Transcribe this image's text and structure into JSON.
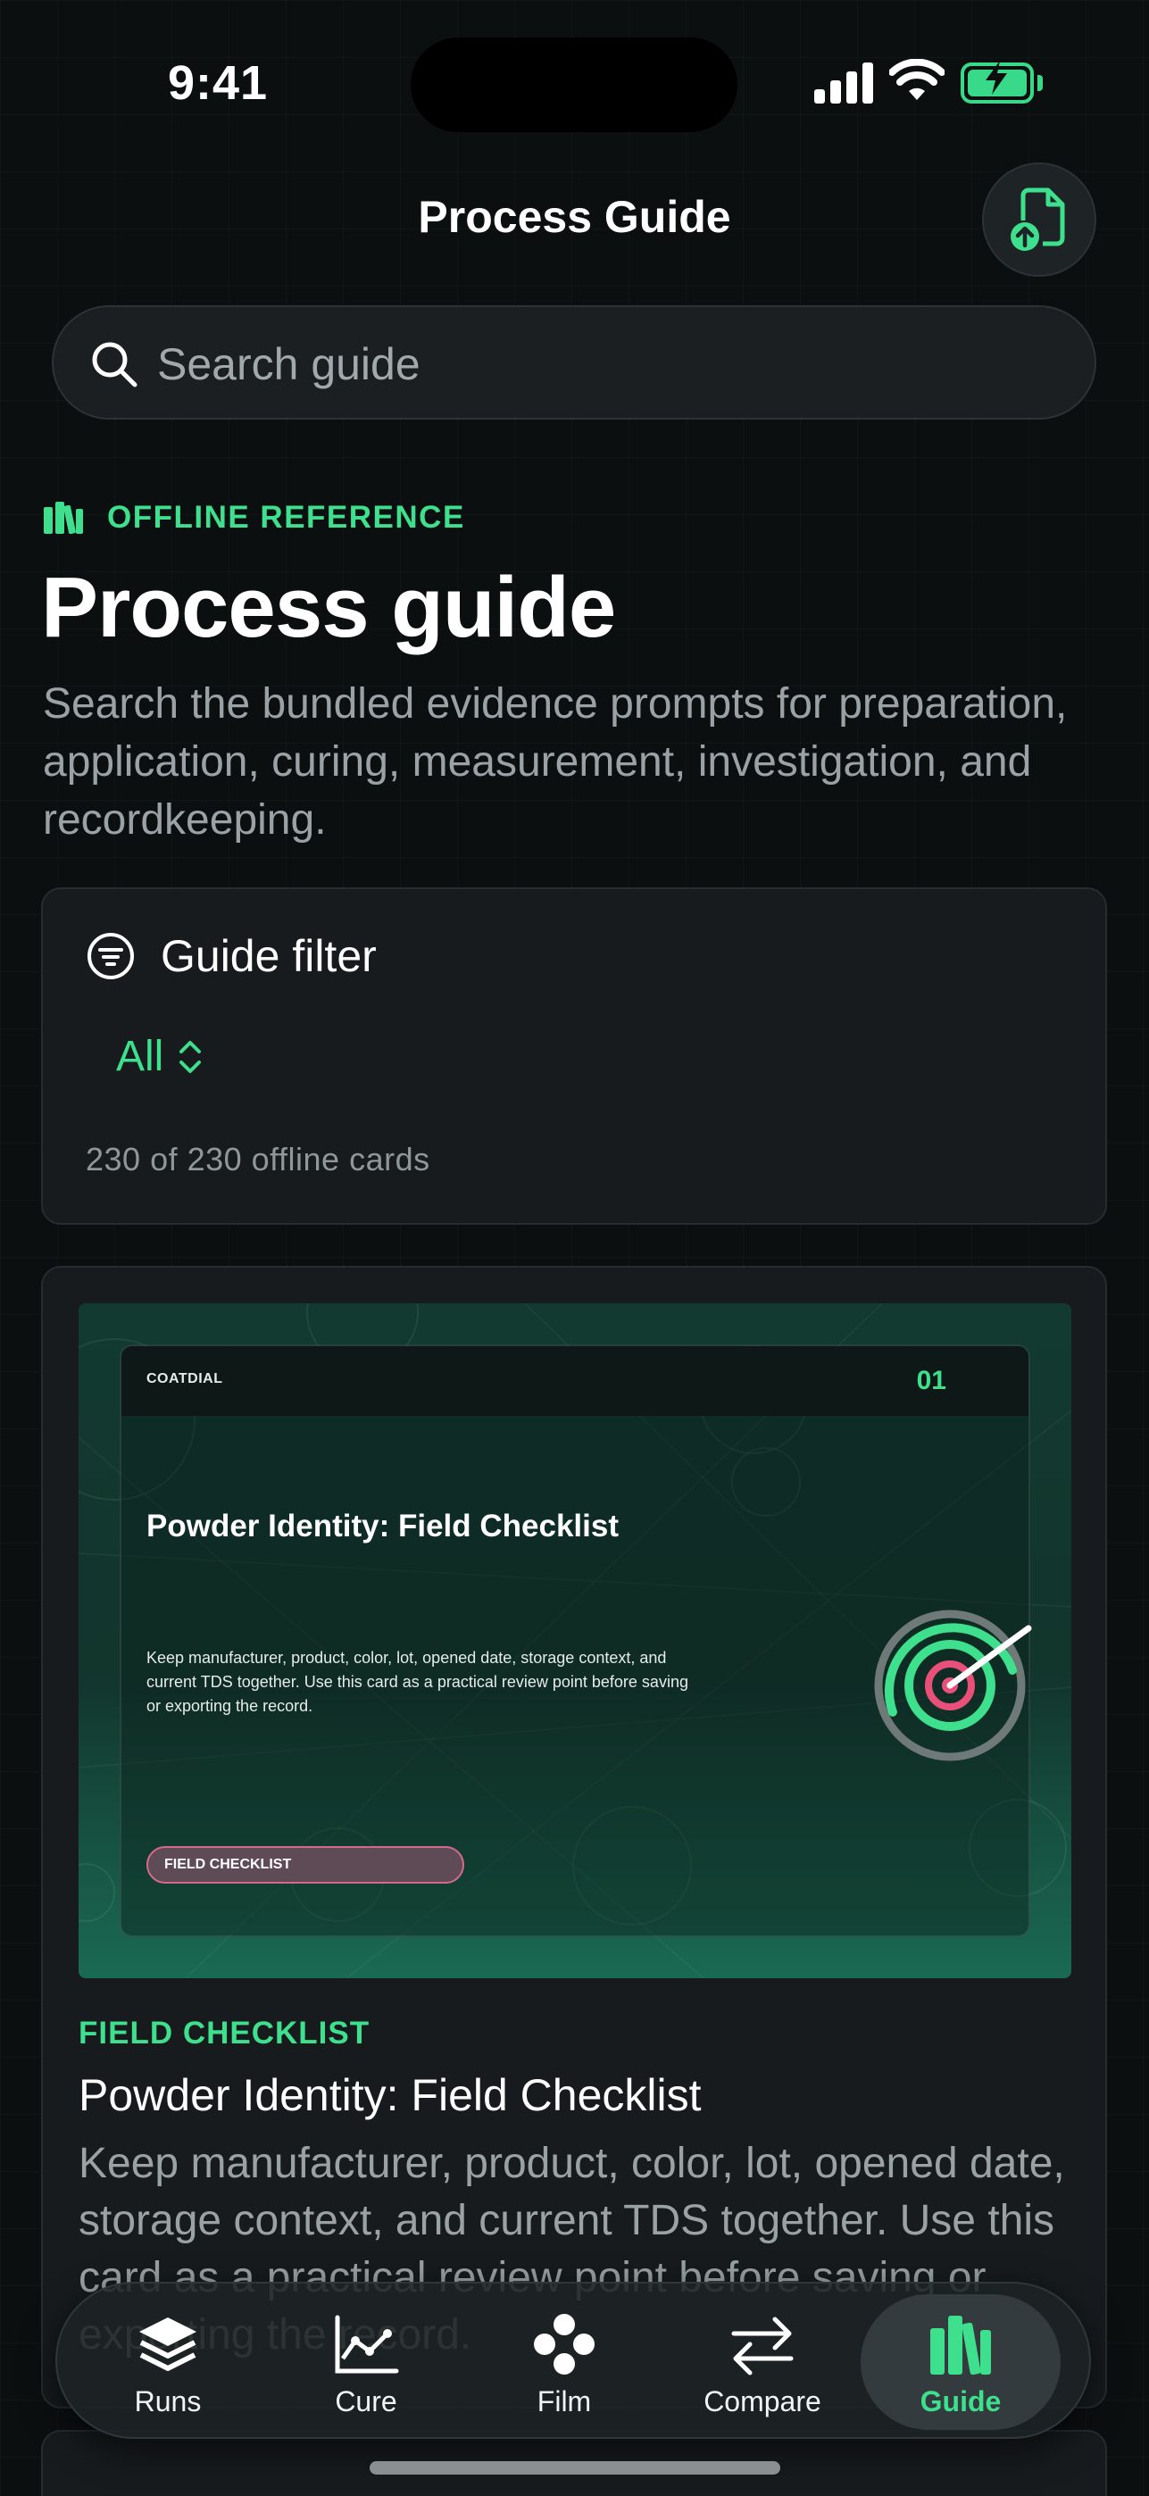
{
  "status_bar": {
    "time": "9:41"
  },
  "nav": {
    "title": "Process Guide",
    "upload_icon": "document-upload-icon"
  },
  "search": {
    "placeholder": "Search guide"
  },
  "header": {
    "eyebrow": "OFFLINE REFERENCE",
    "title": "Process guide",
    "description": "Search the bundled evidence prompts for preparation, application, curing, measurement, investigation, and recordkeeping."
  },
  "filter": {
    "title": "Guide filter",
    "selected": "All",
    "count_text": "230 of 230 offline cards"
  },
  "card": {
    "image": {
      "brand": "COATDIAL",
      "number": "01",
      "title": "Powder Identity: Field Checklist",
      "body": "Keep manufacturer, product, color, lot, opened date, storage context, and current TDS together. Use this card as a practical review point before saving or exporting the record.",
      "pill": "FIELD CHECKLIST"
    },
    "tag": "FIELD CHECKLIST",
    "title": "Powder Identity: Field Checklist",
    "body": "Keep manufacturer, product, color, lot, opened date, storage context, and current TDS together. Use this card as a practical review point before saving or exporting the record."
  },
  "tabs": [
    {
      "label": "Runs",
      "icon": "layers-icon"
    },
    {
      "label": "Cure",
      "icon": "line-chart-icon"
    },
    {
      "label": "Film",
      "icon": "dots-icon"
    },
    {
      "label": "Compare",
      "icon": "arrows-icon"
    },
    {
      "label": "Guide",
      "icon": "books-icon",
      "active": true
    }
  ],
  "colors": {
    "accent": "#3ee08e",
    "background": "#0c0f10",
    "card": "#171b1d",
    "pink": "#e8507a"
  }
}
